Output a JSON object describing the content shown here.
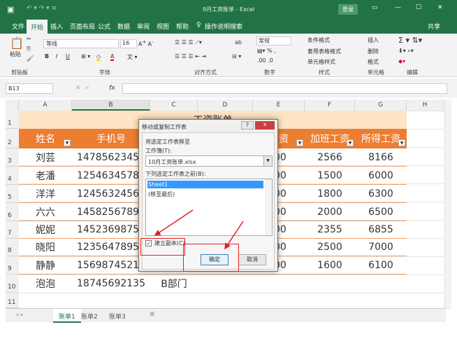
{
  "window": {
    "title": "9月工资账单 - Excel",
    "login": "登录",
    "controls": [
      "restore",
      "minimize",
      "maximize",
      "close"
    ]
  },
  "ribbon_tabs": [
    "文件",
    "开始",
    "插入",
    "页面布局",
    "公式",
    "数据",
    "审阅",
    "视图",
    "帮助"
  ],
  "search": "操作说明搜索",
  "share": "共享",
  "ribbon": {
    "paste": "粘贴",
    "font_name": "等线",
    "font_size": "16",
    "number_format": "常规",
    "cond_format": "条件格式",
    "table_format": "套用表格格式",
    "cell_style": "单元格样式",
    "insert": "插入",
    "delete": "删除",
    "format": "格式",
    "groups": [
      "剪贴板",
      "字体",
      "对齐方式",
      "数字",
      "样式",
      "单元格",
      "编辑"
    ]
  },
  "formula_bar": {
    "name_box": "B13",
    "fx": "fx",
    "value": ""
  },
  "columns": [
    "A",
    "B",
    "C",
    "D",
    "E",
    "F",
    "G",
    "H"
  ],
  "rows": [
    "1",
    "2",
    "3",
    "4",
    "5",
    "6",
    "7",
    "8",
    "9",
    "10",
    "11"
  ],
  "sheet": {
    "title": "工资账单",
    "headers": [
      "姓名",
      "手机号",
      "工资",
      "加班工资",
      "所得工资"
    ],
    "data": [
      [
        "刘芸",
        "14785623456",
        "00",
        "2566",
        "8166"
      ],
      [
        "老潘",
        "12546345789",
        "00",
        "1500",
        "6000"
      ],
      [
        "洋洋",
        "12456324569",
        "00",
        "1800",
        "6300"
      ],
      [
        "六六",
        "14582567895",
        "00",
        "2000",
        "6500"
      ],
      [
        "妮妮",
        "14523698752",
        "00",
        "2355",
        "6855"
      ],
      [
        "晓阳",
        "12356478952",
        "00",
        "2500",
        "7000"
      ],
      [
        "静静",
        "15698745213",
        "00",
        "1600",
        "6100"
      ]
    ],
    "row10": [
      "泡泡",
      "18745692135",
      "B部门"
    ]
  },
  "sheet_tabs": [
    "账单1",
    "账单2",
    "账单3"
  ],
  "dialog": {
    "title": "移动或复制工作表",
    "help": "?",
    "close": "x",
    "move_to": "将选定工作表移至",
    "workbook_label": "工作簿(T):",
    "workbook": "10月工资账单.xlsx",
    "before_label": "下列选定工作表之前(B):",
    "list": [
      "Sheet1",
      "(移至最后)"
    ],
    "copy_label": "建立副本(C)",
    "copy_checked": true,
    "ok": "确定",
    "cancel": "取消"
  },
  "colors": {
    "excel_green": "#217346",
    "header_orange": "#ed7d31",
    "title_fill": "#fce4c4",
    "annotation_red": "#e02020"
  }
}
